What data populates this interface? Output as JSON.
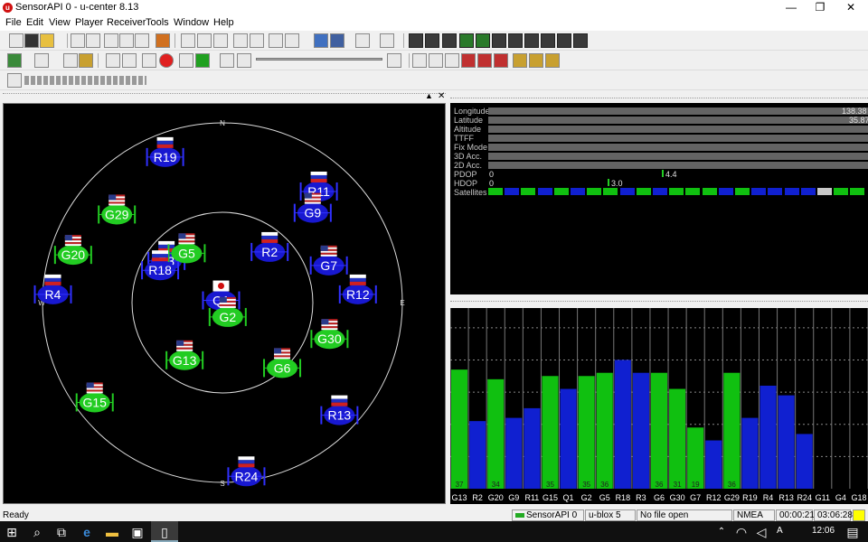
{
  "window": {
    "title": "SensorAPI 0 - u-center 8.13",
    "minimize_glyph": "—",
    "restore_glyph": "❐",
    "close_glyph": "✕"
  },
  "menu": [
    "File",
    "Edit",
    "View",
    "Player",
    "Receiver",
    "Tools",
    "Window",
    "Help"
  ],
  "sky": {
    "compass": {
      "n": "N",
      "s": "S",
      "e": "E",
      "w": "W"
    },
    "satellites": [
      {
        "id": "R19",
        "flag": "ru",
        "color": "blue",
        "az": -21,
        "el": 10
      },
      {
        "id": "R11",
        "flag": "ru",
        "color": "blue",
        "az": 40,
        "el": 15
      },
      {
        "id": "G9",
        "flag": "us",
        "color": "blue",
        "az": 44,
        "el": 25
      },
      {
        "id": "G29",
        "flag": "us",
        "color": "green",
        "az": -49,
        "el": 20
      },
      {
        "id": "R2",
        "flag": "ru",
        "color": "blue",
        "az": 41,
        "el": 54
      },
      {
        "id": "R3",
        "flag": "ru",
        "color": "blue",
        "az": -51,
        "el": 54
      },
      {
        "id": "G5",
        "flag": "us",
        "color": "green",
        "az": -34,
        "el": 58
      },
      {
        "id": "G20",
        "flag": "us",
        "color": "green",
        "az": -71,
        "el": 11
      },
      {
        "id": "G7",
        "flag": "us",
        "color": "blue",
        "az": 69,
        "el": 33
      },
      {
        "id": "R18",
        "flag": "ru",
        "color": "blue",
        "az": -60,
        "el": 54
      },
      {
        "id": "Q1",
        "flag": "jp",
        "color": "blue",
        "az": -13,
        "el": 87
      },
      {
        "id": "R12",
        "flag": "ru",
        "color": "blue",
        "az": 85,
        "el": 22
      },
      {
        "id": "G2",
        "flag": "us",
        "color": "green",
        "az": 154,
        "el": 84
      },
      {
        "id": "R4",
        "flag": "ru",
        "color": "blue",
        "az": -86,
        "el": 5
      },
      {
        "id": "G30",
        "flag": "us",
        "color": "green",
        "az": 107,
        "el": 34
      },
      {
        "id": "G13",
        "flag": "us",
        "color": "green",
        "az": -145,
        "el": 57
      },
      {
        "id": "G6",
        "flag": "us",
        "color": "green",
        "az": 136,
        "el": 47
      },
      {
        "id": "G15",
        "flag": "us",
        "color": "green",
        "az": -127,
        "el": 10
      },
      {
        "id": "R13",
        "flag": "ru",
        "color": "blue",
        "az": 133,
        "el": 10
      },
      {
        "id": "R24",
        "flag": "ru",
        "color": "blue",
        "az": 172,
        "el": 4
      }
    ]
  },
  "info": {
    "rows": [
      "Longitude",
      "Latitude",
      "Altitude",
      "TTFF",
      "Fix Mode",
      "3D Acc.",
      "2D Acc.",
      "PDOP",
      "HDOP",
      "Satellites"
    ],
    "longitude": "138.38",
    "latitude": "35.87",
    "pdop_zero": "0",
    "pdop": "4.4",
    "hdop_zero": "0",
    "hdop": "3.0",
    "sat_pattern": [
      "green",
      "blue",
      "green",
      "blue",
      "green",
      "blue",
      "green",
      "green",
      "blue",
      "green",
      "blue",
      "green",
      "green",
      "green",
      "blue",
      "green",
      "blue",
      "blue",
      "blue",
      "blue",
      "grey",
      "green",
      "green"
    ]
  },
  "chart_data": {
    "type": "bar",
    "categories": [
      "G13",
      "R2",
      "G20",
      "G9",
      "R11",
      "G15",
      "Q1",
      "G2",
      "G5",
      "R18",
      "R3",
      "G6",
      "G30",
      "G7",
      "R12",
      "G29",
      "R19",
      "R4",
      "R13",
      "R24",
      "G11",
      "G4",
      "G18"
    ],
    "values": [
      37,
      0,
      34,
      0,
      0,
      35,
      0,
      35,
      36,
      0,
      0,
      36,
      31,
      19,
      0,
      36,
      0,
      0,
      0,
      0,
      0,
      0,
      0
    ],
    "heights": [
      37,
      21,
      34,
      22,
      25,
      35,
      31,
      35,
      36,
      40,
      36,
      36,
      31,
      19,
      15,
      36,
      22,
      32,
      29,
      17,
      0,
      0,
      0
    ],
    "colors": [
      "green",
      "blue",
      "green",
      "blue",
      "blue",
      "green",
      "blue",
      "green",
      "green",
      "blue",
      "blue",
      "green",
      "green",
      "green",
      "blue",
      "green",
      "blue",
      "blue",
      "blue",
      "blue",
      "none",
      "none",
      "none"
    ],
    "ylim": [
      0,
      55
    ]
  },
  "status": {
    "ready": "Ready",
    "port": "SensorAPI 0",
    "receiver": "u-blox 5",
    "file": "No file open",
    "protocol": "NMEA",
    "elapsed": "00:00:21",
    "clock": "03:06:28"
  },
  "taskbar": {
    "time": "12:06",
    "lang": "A",
    "start_icon": "⊞",
    "search_icon": "⌕",
    "taskview_icon": "⧉",
    "edge_icon": "e",
    "explorer_icon": "▬",
    "store_icon": "▣",
    "ucenter_icon": "▯",
    "chevron_icon": "⌃",
    "wifi_icon": "◠",
    "volume_icon": "◁",
    "notification_icon": "▤"
  }
}
